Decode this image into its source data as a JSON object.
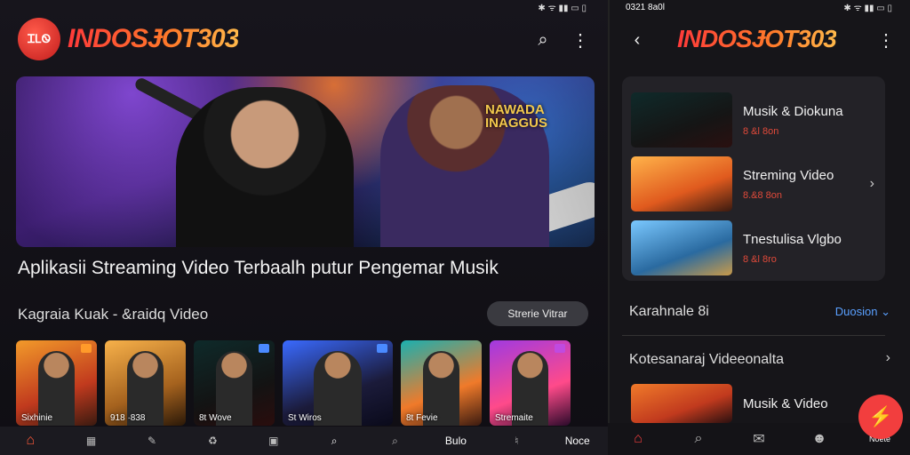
{
  "left": {
    "status_icons": "✱ ᯤ ▮▮ ▭ ▯",
    "logo_badge": "ᏆᏞᏫ",
    "brand": "INDOSɈOT303",
    "hero_sign": "NAWADA INAGGUS",
    "headline": "Aplikasii Streaming Video Terbaalh putur Pengemar Musik",
    "subhead": "Kagraia Kuak - &raidq Video",
    "pill_label": "Strerie Vitrar",
    "thumbs": [
      {
        "cap": "Sixhinie"
      },
      {
        "cap": "918 ·838"
      },
      {
        "cap": "8t Wove"
      },
      {
        "cap": "St Wiros"
      },
      {
        "cap": "8t Fevie"
      },
      {
        "cap": "Stremaite"
      }
    ],
    "nav": [
      "⌂",
      "▦",
      "✎",
      "♻",
      "▣",
      "⌕",
      "⌕",
      "Bulo",
      "♮",
      "Noce"
    ]
  },
  "right": {
    "status_time": "0321 8a0l",
    "brand": "INDOSɈOT303",
    "rows": [
      {
        "title": "Musik & Diokuna",
        "meta": "8 &l 8on"
      },
      {
        "title": "Streming Video",
        "meta": "8.&8 8on"
      },
      {
        "title": "Tnestulisa Vlgbo",
        "meta": "8 &l 8ro"
      }
    ],
    "sec1": "Karahnale 8i",
    "sec1_link": "Duosion ⌄",
    "sec2": "Kotesanaraj Videeonalta",
    "sec3_title": "Musik & Video",
    "nav": [
      "⌂",
      "⌕",
      "✉",
      "☻"
    ],
    "fab": "⚡",
    "fab_label": "Noete"
  }
}
